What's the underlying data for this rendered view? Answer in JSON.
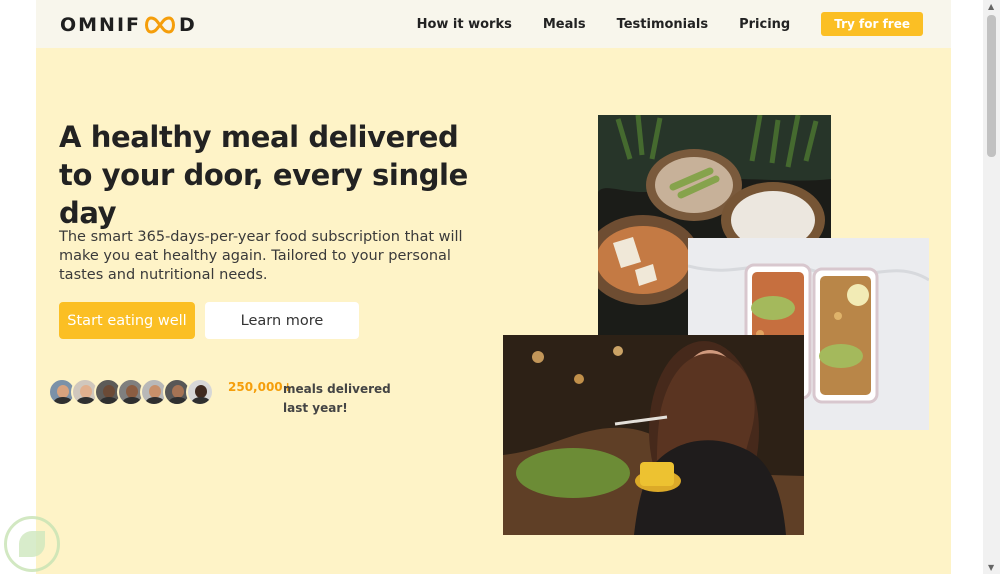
{
  "header": {
    "logo_text_start": "OMNIF",
    "logo_text_end": "D",
    "nav": [
      "How it works",
      "Meals",
      "Testimonials",
      "Pricing"
    ],
    "cta": "Try for free"
  },
  "hero": {
    "title": "A healthy meal delivered to your door, every single day",
    "description": "The smart 365-days-per-year food subscription that will make you eat healthy again. Tailored to your personal tastes and nutritional needs.",
    "primary_button": "Start eating well",
    "secondary_button": "Learn more"
  },
  "delivered": {
    "count": "250,000+",
    "text": "meals delivered last year!"
  },
  "avatar_colors": [
    "#d8a27e",
    "#e1b08e",
    "#6b4a36",
    "#8b5d42",
    "#c8906a",
    "#a57354",
    "#3f2a1f"
  ],
  "colors": {
    "accent": "#fbbf24",
    "background": "#fef3c7",
    "header": "#f8f6ec"
  },
  "icons": {
    "logo": "infinity-icon",
    "watermark": "leaf-icon"
  }
}
